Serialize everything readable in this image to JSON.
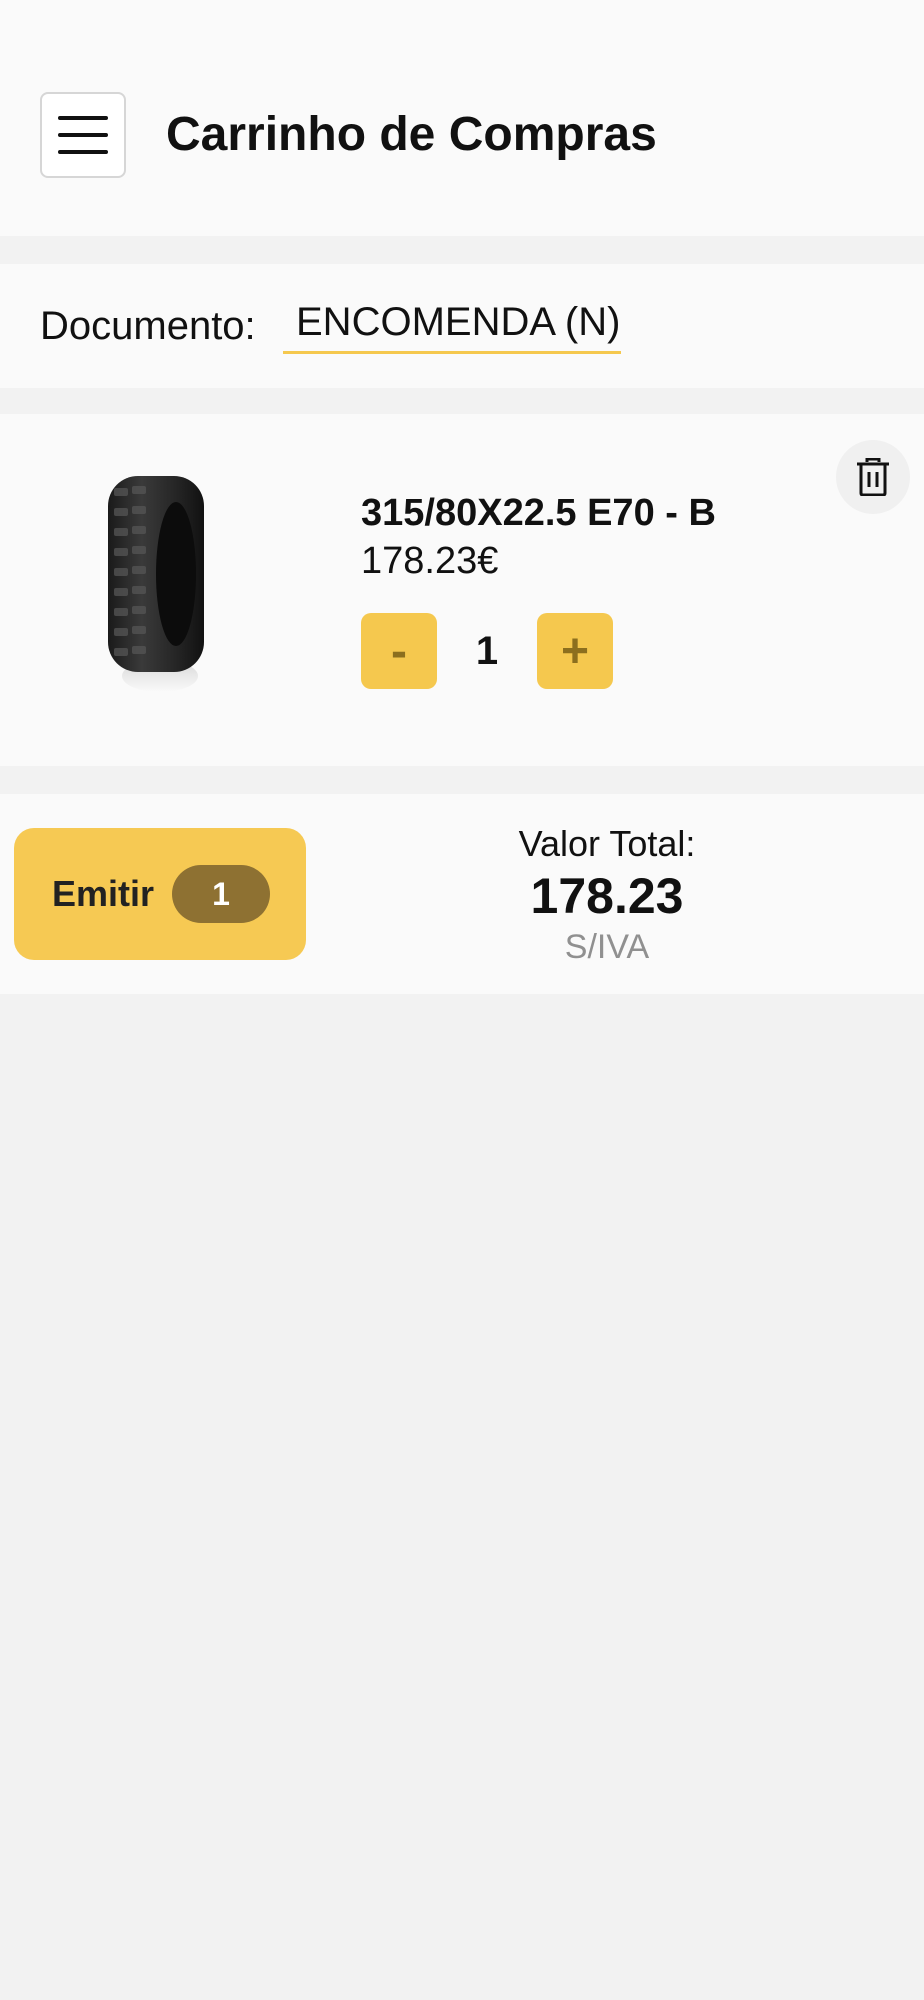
{
  "header": {
    "title": "Carrinho de Compras",
    "menu_icon": "hamburger-menu-icon"
  },
  "document": {
    "label": "Documento:",
    "selected": "ENCOMENDA (N)"
  },
  "cart": {
    "items": [
      {
        "image": "truck-tyre-image",
        "name": "315/80X22.5 E70 - B",
        "price": "178.23€",
        "quantity": "1",
        "minus_label": "-",
        "plus_label": "+",
        "delete_icon": "trash-icon"
      }
    ]
  },
  "footer": {
    "emit_label": "Emitir",
    "emit_count": "1",
    "total_label": "Valor Total:",
    "total_value": "178.23",
    "tax_note": "S/IVA"
  },
  "colors": {
    "accent": "#f5c84e",
    "badge": "#8e7132",
    "background": "#f2f2f2",
    "panel": "#fafafa"
  }
}
